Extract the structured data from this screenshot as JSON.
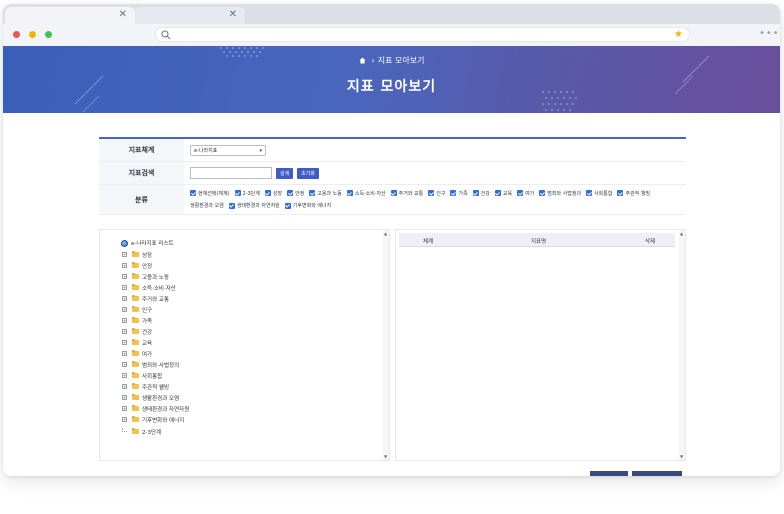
{
  "hero": {
    "breadcrumb": "지표 모아보기",
    "title": "지표 모아보기",
    "gradient_start": "#3a5fb8",
    "gradient_end": "#6a4f9c"
  },
  "filter": {
    "system": {
      "label": "지표체계",
      "selected": "e-나라지표"
    },
    "search": {
      "label": "지표검색",
      "value": "",
      "search_button": "검색",
      "reset_button": "초기화"
    },
    "category": {
      "label": "분류",
      "items": [
        "현재선택(체계)",
        "2-3단계",
        "성장",
        "안정",
        "고용과 노동",
        "소득·소비·자산",
        "주거와 교통",
        "인구",
        "가족",
        "건강",
        "교육",
        "여가",
        "범죄와 사법정의",
        "사회통합",
        "주관적 웰빙",
        "생활환경과 오염",
        "생태환경과 자연자원",
        "기후변화와 에너지"
      ]
    }
  },
  "tree": {
    "root": "e-나라지표 리스트",
    "items": [
      "성장",
      "안정",
      "고용과 노동",
      "소득·소비·자산",
      "주거와 교통",
      "인구",
      "가족",
      "건강",
      "교육",
      "여가",
      "범죄와 사법정의",
      "사회통합",
      "주관적 웰빙",
      "생활환경과 오염",
      "생태환경과 자연자원",
      "기후변화와 에너지"
    ],
    "last": "2-3단계"
  },
  "grid": {
    "columns": [
      "체계",
      "지표명",
      "삭제"
    ]
  },
  "colors": {
    "accent": "#3f5cc4",
    "checkbox": "#2f6de0",
    "folder": "#f2c14e"
  }
}
